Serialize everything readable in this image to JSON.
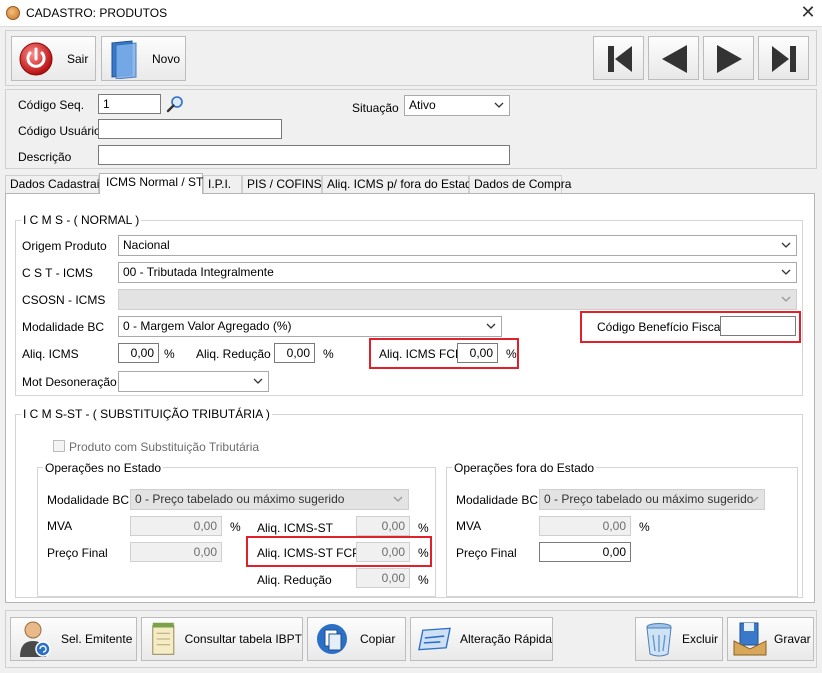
{
  "window": {
    "title": "CADASTRO: PRODUTOS",
    "close_glyph": "✕"
  },
  "toolbar": {
    "sair_label": "Sair",
    "novo_label": "Novo"
  },
  "header": {
    "codigo_seq_label": "Código Seq.",
    "codigo_seq_value": "1",
    "situacao_label": "Situação",
    "situacao_value": "Ativo",
    "codigo_usuario_label": "Código Usuário",
    "codigo_usuario_value": "",
    "descricao_label": "Descrição",
    "descricao_value": ""
  },
  "tabs": [
    {
      "label": "Dados Cadastrais"
    },
    {
      "label": "ICMS Normal / ST"
    },
    {
      "label": "I.P.I."
    },
    {
      "label": "PIS / COFINS"
    },
    {
      "label": "Aliq. ICMS p/ fora do Estado"
    },
    {
      "label": "Dados de Compra"
    }
  ],
  "icms_normal": {
    "group_title": "I C M S - ( NORMAL )",
    "origem_label": "Origem Produto",
    "origem_value": "Nacional",
    "cst_label": "C S T - ICMS",
    "cst_value": "00 - Tributada Integralmente",
    "csosn_label": "CSOSN - ICMS",
    "csosn_value": "",
    "modalidade_label": "Modalidade BC",
    "modalidade_value": "0 - Margem Valor Agregado (%)",
    "codigo_beneficio_label": "Código Benefício Fiscal",
    "codigo_beneficio_value": "",
    "aliq_icms_label": "Aliq. ICMS",
    "aliq_icms_value": "0,00",
    "aliq_reducao_label": "Aliq. Redução",
    "aliq_reducao_value": "0,00",
    "aliq_fcp_label": "Aliq. ICMS FCP",
    "aliq_fcp_value": "0,00",
    "percent": "%",
    "mot_desoneracao_label": "Mot Desoneração",
    "mot_desoneracao_value": ""
  },
  "icms_st": {
    "group_title": "I C M S-ST - ( SUBSTITUIÇÃO TRIBUTÁRIA )",
    "checkbox_label": "Produto com Substituição Tributária",
    "no_estado": {
      "title": "Operações no Estado",
      "modalidade_label": "Modalidade BC",
      "modalidade_value": "0 - Preço tabelado ou máximo sugerido",
      "mva_label": "MVA",
      "mva_value": "0,00",
      "preco_final_label": "Preço Final",
      "preco_final_value": "0,00",
      "aliq_icms_st_label": "Aliq. ICMS-ST",
      "aliq_icms_st_value": "0,00",
      "aliq_icms_st_fcp_label": "Aliq. ICMS-ST FCP",
      "aliq_icms_st_fcp_value": "0,00",
      "aliq_reducao_label": "Aliq. Redução",
      "aliq_reducao_value": "0,00"
    },
    "fora_estado": {
      "title": "Operações fora do Estado",
      "modalidade_label": "Modalidade BC",
      "modalidade_value": "0 - Preço tabelado ou máximo sugerido",
      "mva_label": "MVA",
      "mva_value": "0,00",
      "preco_final_label": "Preço Final",
      "preco_final_value": "0,00"
    }
  },
  "footer": {
    "sel_emitente_label": "Sel. Emitente",
    "consultar_ibpt_label": "Consultar tabela IBPT",
    "copiar_label": "Copiar",
    "alteracao_rapida_label": "Alteração Rápida",
    "excluir_label": "Excluir",
    "gravar_label": "Gravar"
  },
  "colors": {
    "highlight": "#e0202a",
    "accent_blue": "#2b6fc7"
  }
}
